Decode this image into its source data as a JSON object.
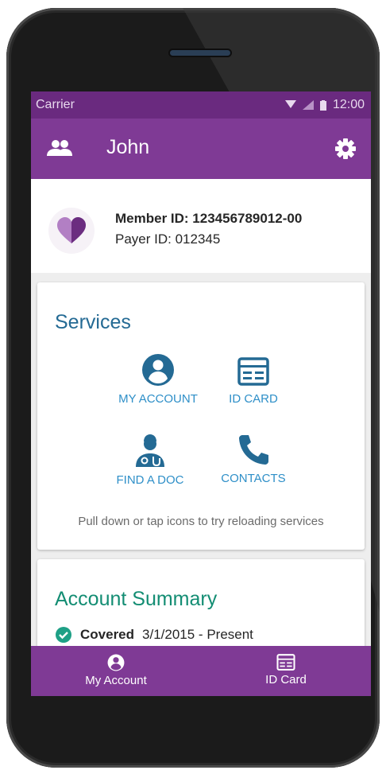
{
  "statusbar": {
    "carrier": "Carrier",
    "time": "12:00"
  },
  "appbar": {
    "title": "John"
  },
  "member": {
    "member_id": "Member ID: 123456789012-00",
    "payer_id": "Payer ID: 012345"
  },
  "services": {
    "title": "Services",
    "items": [
      {
        "label": "MY ACCOUNT",
        "icon": "account-circle-icon"
      },
      {
        "label": "ID CARD",
        "icon": "id-card-icon"
      },
      {
        "label": "FIND A DOC",
        "icon": "doctor-icon"
      },
      {
        "label": "CONTACTS",
        "icon": "phone-icon"
      }
    ],
    "hint": "Pull down or tap icons to try reloading services"
  },
  "summary": {
    "title": "Account Summary",
    "status": "Covered",
    "period": "3/1/2015 - Present"
  },
  "bottomnav": {
    "items": [
      {
        "label": "My Account"
      },
      {
        "label": "ID Card"
      }
    ]
  },
  "colors": {
    "primary": "#7f3a95",
    "statusbar": "#6a2a7f",
    "services_title": "#246a94",
    "summary_title": "#138d73",
    "link": "#2e8fc8",
    "check": "#1ea086"
  }
}
